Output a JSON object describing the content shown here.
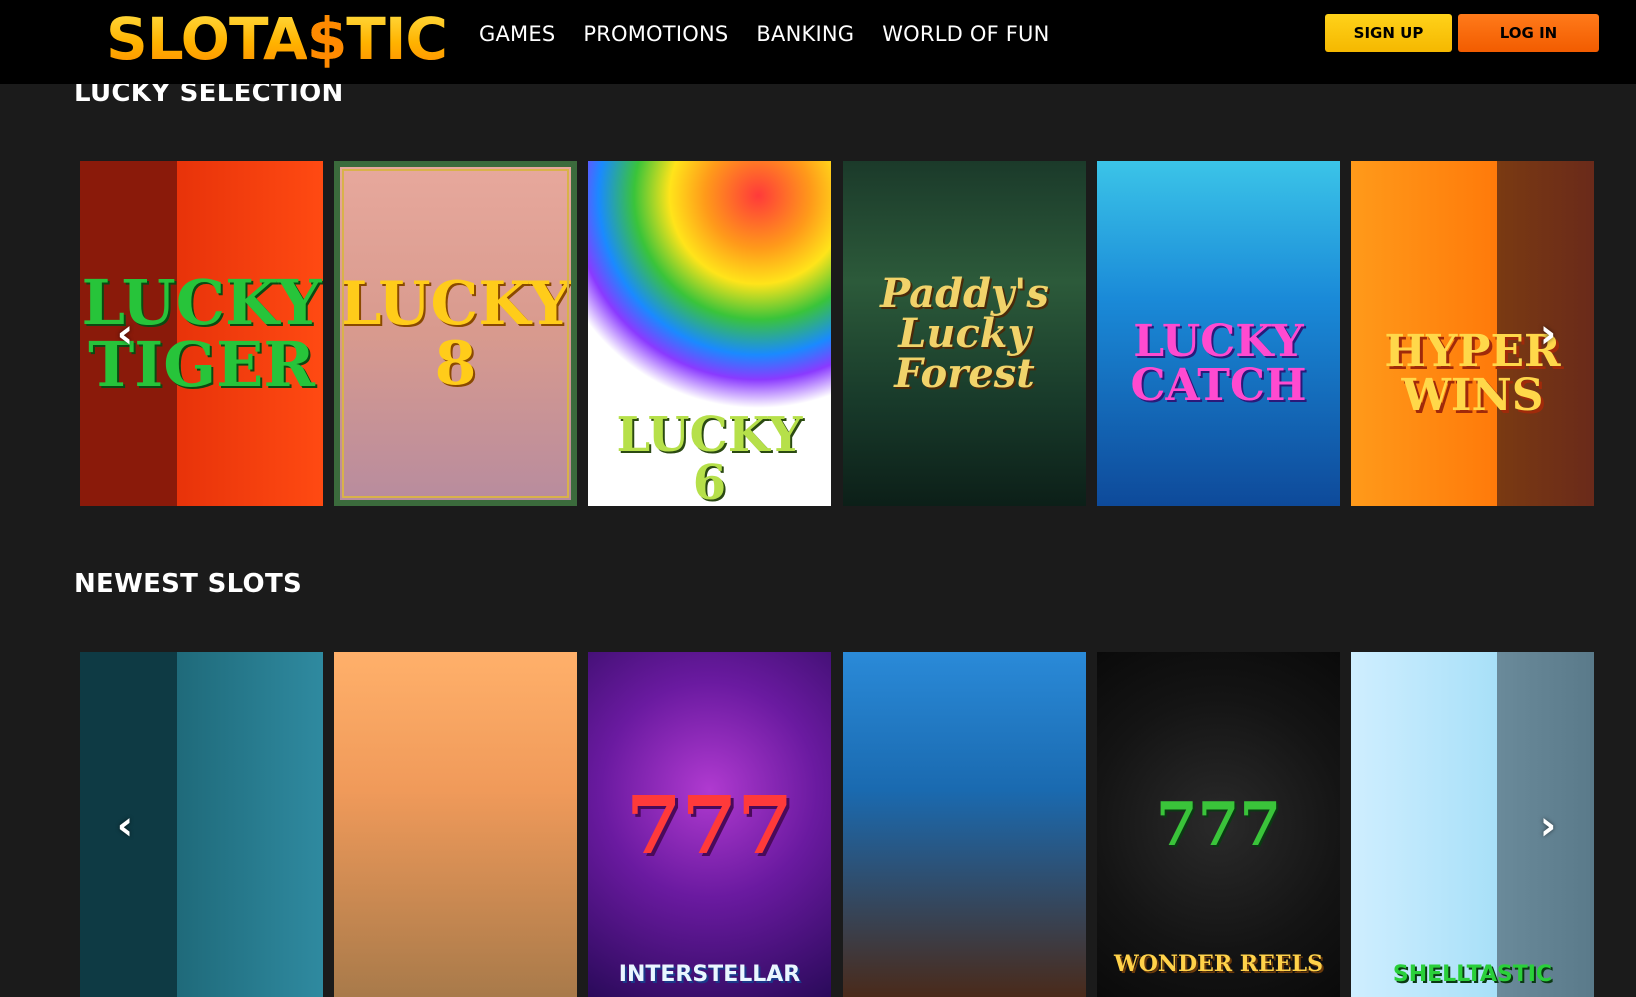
{
  "header": {
    "logo_text_a": "SLOTA",
    "logo_text_dollar": "$",
    "logo_text_b": "TIC",
    "nav": [
      "GAMES",
      "PROMOTIONS",
      "BANKING",
      "WORLD OF FUN"
    ],
    "sign_up_label": "SIGN UP",
    "log_in_label": "LOG IN"
  },
  "sections": [
    {
      "title": "LUCKY SELECTION",
      "tiles": [
        {
          "label": "LUCKY TIGER"
        },
        {
          "label": "LUCKY 8"
        },
        {
          "label": "LUCKY 6"
        },
        {
          "label": "Paddy's Lucky Forest"
        },
        {
          "label": "LUCKY CATCH"
        },
        {
          "label": "HYPER WINS"
        }
      ]
    },
    {
      "title": "NEWEST SLOTS",
      "tiles": [
        {
          "label": ""
        },
        {
          "label": ""
        },
        {
          "label": "777",
          "sublabel": "INTERSTELLAR"
        },
        {
          "label": ""
        },
        {
          "label": "777",
          "sublabel": "WONDER REELS"
        },
        {
          "label": "",
          "sublabel": "SHELLTASTIC"
        }
      ]
    }
  ],
  "arrows": {
    "prev": "‹",
    "next": "›"
  },
  "colors": {
    "background": "#1b1b1b",
    "header": "#000000",
    "sign_up": "#ffd21a",
    "log_in": "#ff7a1a"
  }
}
